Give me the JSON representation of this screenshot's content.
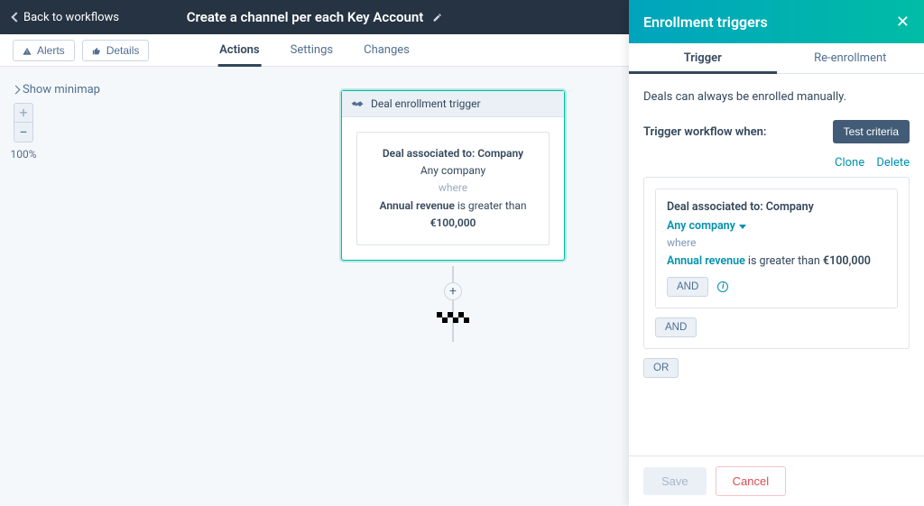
{
  "header": {
    "back_label": "Back to workflows",
    "title": "Create a channel per each Key Account"
  },
  "subheader": {
    "alerts_label": "Alerts",
    "details_label": "Details",
    "tabs": [
      {
        "label": "Actions"
      },
      {
        "label": "Settings"
      },
      {
        "label": "Changes"
      }
    ]
  },
  "canvas": {
    "minimap_label": "Show minimap",
    "zoom_in": "+",
    "zoom_out": "−",
    "zoom_value": "100%",
    "node": {
      "header": "Deal enrollment trigger",
      "assoc_line": "Deal associated to: Company",
      "any_company": "Any company",
      "where": "where",
      "cond_1a": "Annual revenue",
      "cond_1b": " is greater than",
      "value": "€100,000"
    },
    "plus": "+"
  },
  "drawer": {
    "title": "Enrollment triggers",
    "tabs": [
      {
        "label": "Trigger"
      },
      {
        "label": "Re-enrollment"
      }
    ],
    "note": "Deals can always be enrolled manually.",
    "trigger_label": "Trigger workflow when:",
    "test_criteria": "Test criteria",
    "clone": "Clone",
    "delete": "Delete",
    "criteria": {
      "assoc_line": "Deal associated to: Company",
      "any_company": "Any company",
      "where": "where",
      "prop": "Annual revenue",
      "mid": " is greater than ",
      "value": "€100,000",
      "and": "AND",
      "or": "OR"
    },
    "save": "Save",
    "cancel": "Cancel"
  }
}
